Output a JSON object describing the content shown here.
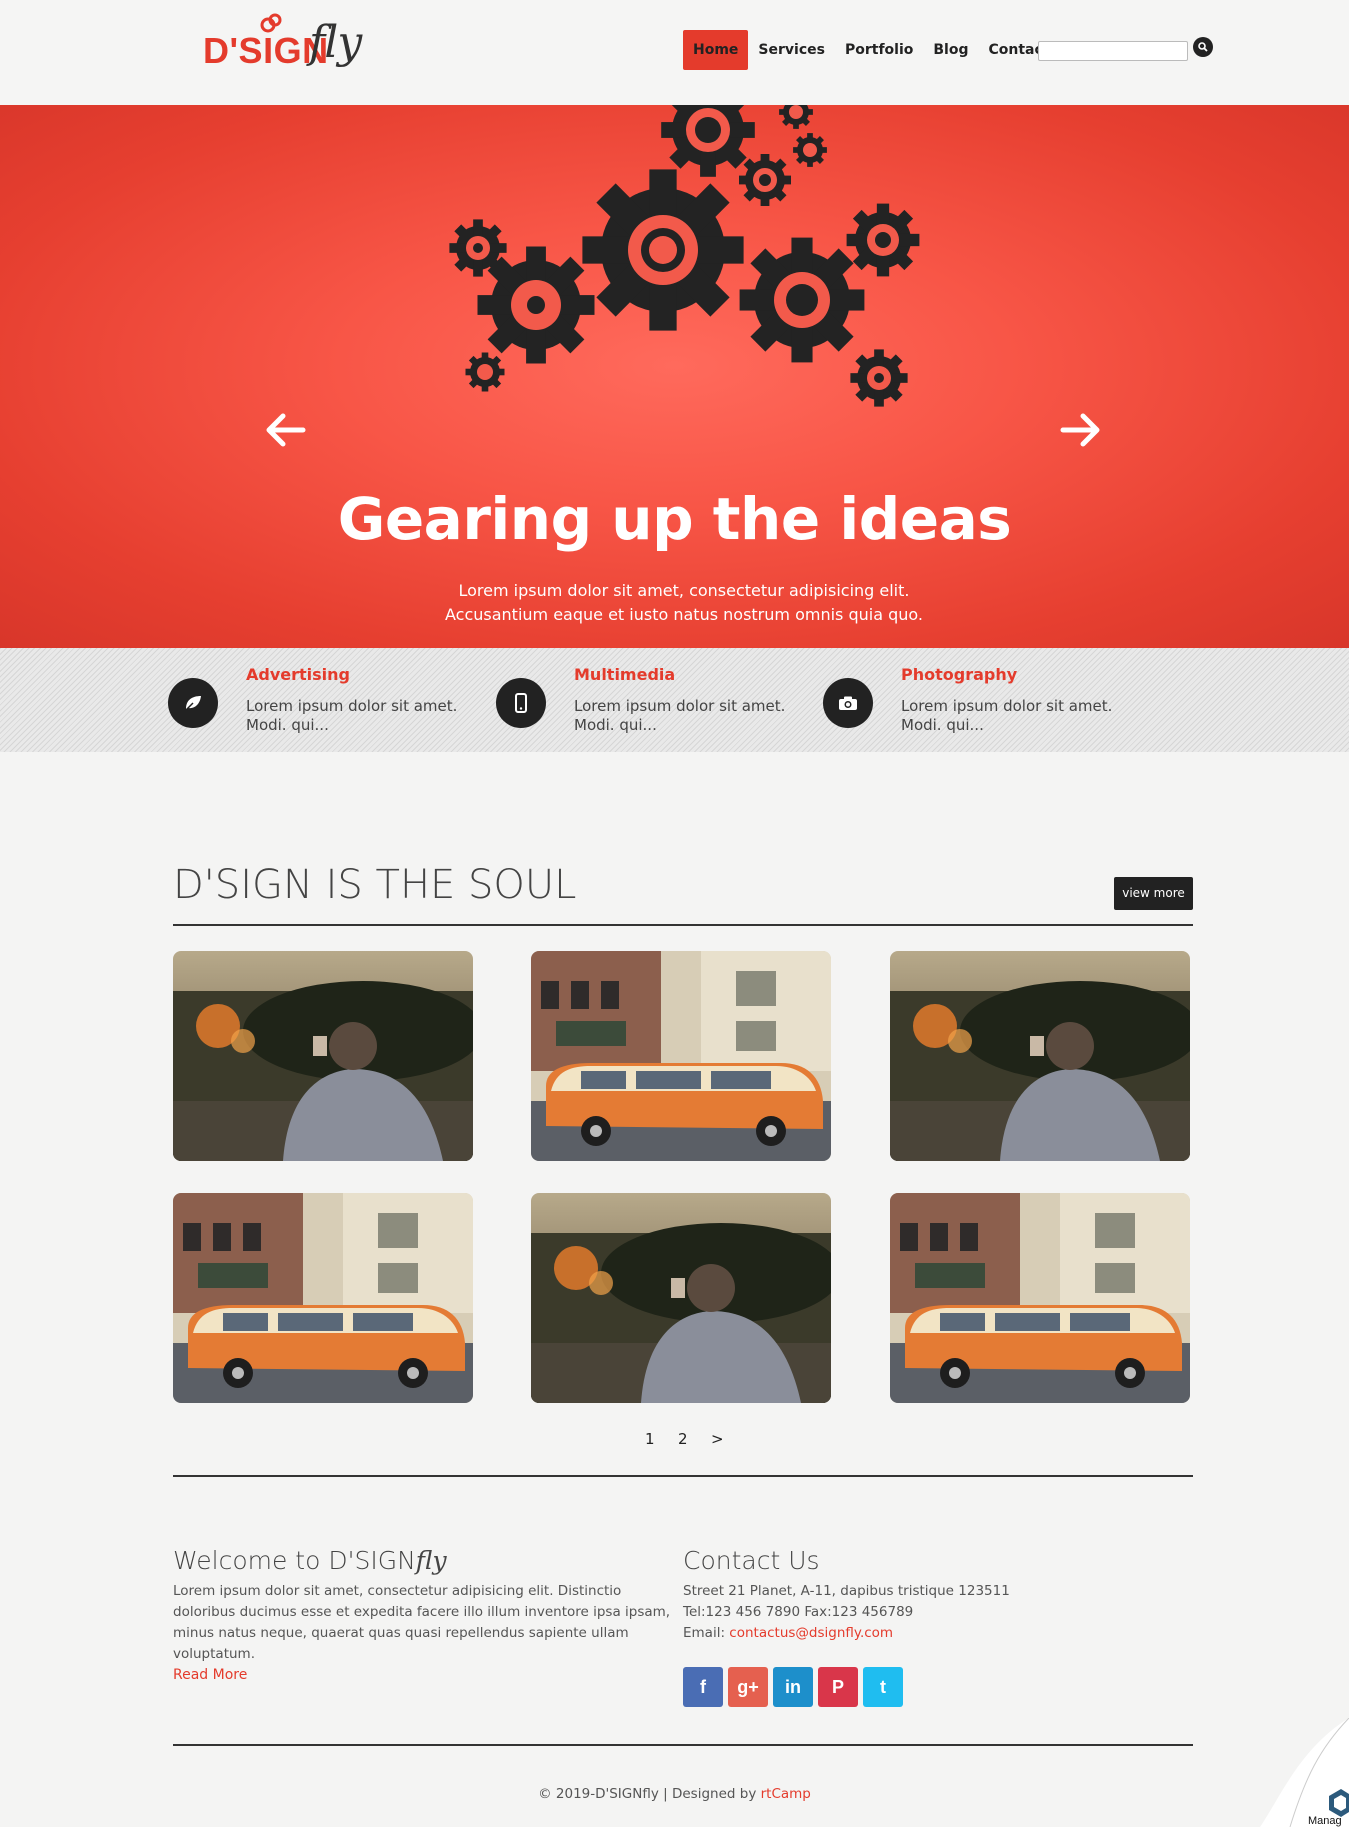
{
  "brand": {
    "logo_main": "D'SIGN",
    "logo_script": "fly"
  },
  "nav": {
    "items": [
      {
        "label": "Home",
        "active": true
      },
      {
        "label": "Services"
      },
      {
        "label": "Portfolio"
      },
      {
        "label": "Blog"
      },
      {
        "label": "Contact"
      }
    ],
    "search_placeholder": ""
  },
  "hero": {
    "title": "Gearing up the ideas",
    "text": "Lorem ipsum dolor sit amet, consectetur adipisicing elit. Accusantium eaque et iusto natus nostrum omnis quia quo."
  },
  "features": [
    {
      "title": "Advertising",
      "text": "Lorem ipsum dolor sit amet. Modi. qui...",
      "icon": "leaf-icon"
    },
    {
      "title": "Multimedia",
      "text": "Lorem ipsum dolor sit amet. Modi. qui...",
      "icon": "mobile-icon"
    },
    {
      "title": "Photography",
      "text": "Lorem ipsum dolor sit amet. Modi. qui...",
      "icon": "camera-icon"
    }
  ],
  "portfolio": {
    "title": "D'SIGN IS THE SOUL",
    "view_more": "view more",
    "items": [
      "photographer",
      "van",
      "photographer",
      "van",
      "photographer",
      "van"
    ],
    "pagination": [
      "1",
      "2",
      ">"
    ]
  },
  "welcome": {
    "title_prefix": "Welcome to D'SIGN",
    "title_script": "fly",
    "text": "Lorem ipsum dolor sit amet, consectetur adipisicing elit. Distinctio doloribus ducimus esse et expedita facere illo illum inventore ipsa ipsam, minus natus neque, quaerat quas quasi repellendus sapiente ullam voluptatum.",
    "read_more": "Read More"
  },
  "contact": {
    "title": "Contact Us",
    "address": "Street 21 Planet, A-11, dapibus tristique 123511",
    "phone": "Tel:123 456 7890 Fax:123 456789",
    "email_label": "Email: ",
    "email": "contactus@dsignfly.com",
    "social": [
      {
        "name": "facebook",
        "glyph": "f",
        "color": "#4a6db4"
      },
      {
        "name": "google-plus",
        "glyph": "g+",
        "color": "#e5604f"
      },
      {
        "name": "linkedin",
        "glyph": "in",
        "color": "#1d8fcb"
      },
      {
        "name": "pinterest",
        "glyph": "P",
        "color": "#d9364a"
      },
      {
        "name": "twitter",
        "glyph": "t",
        "color": "#1fbdf0"
      }
    ]
  },
  "footer": {
    "copyright": "© 2019-D'SIGNfly | Designed by ",
    "designer": "rtCamp"
  },
  "corner_badge": {
    "label": "Manag"
  },
  "colors": {
    "accent": "#e43b2c",
    "dark": "#222222",
    "bg": "#f4f4f3"
  }
}
